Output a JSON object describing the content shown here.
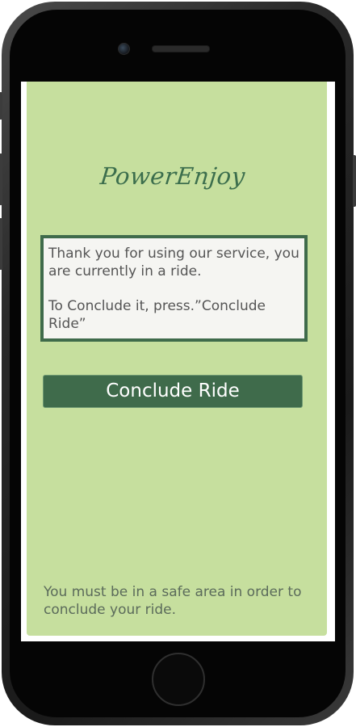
{
  "app": {
    "logo": "PowerEnjoy"
  },
  "message": {
    "line1": "Thank you for using our service, you are currently in a ride.",
    "line2": "To Conclude it, press.”Conclude Ride”"
  },
  "actions": {
    "conclude_label": "Conclude Ride"
  },
  "footer": {
    "note": "You must be in a safe area in order to conclude your ride."
  },
  "colors": {
    "background": "#c6df9e",
    "accent": "#3f6b4b",
    "message_bg": "#f5f5f2"
  }
}
